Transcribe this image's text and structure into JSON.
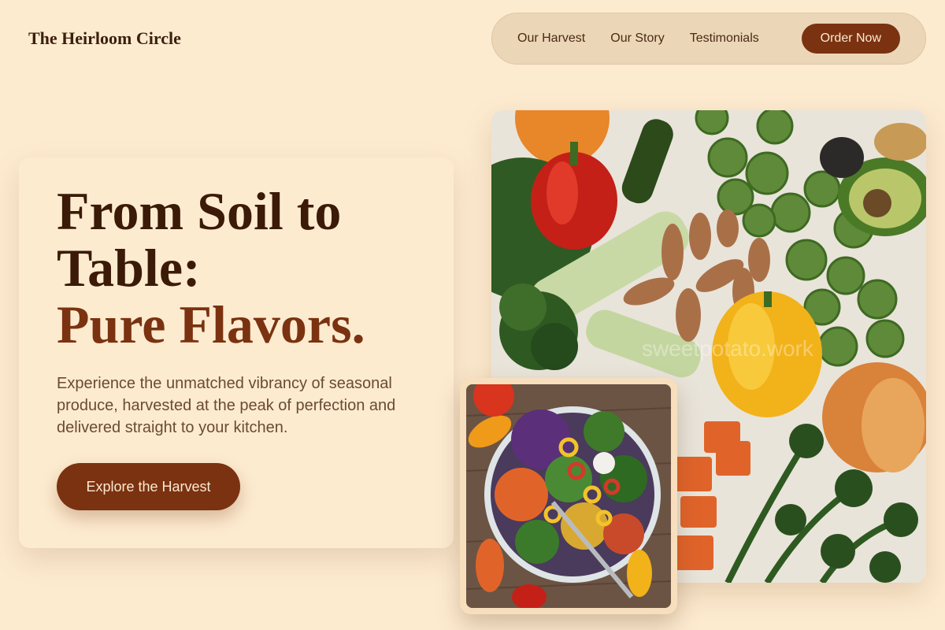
{
  "brand": {
    "name": "The Heirloom Circle"
  },
  "nav": {
    "items": [
      {
        "label": "Our Harvest"
      },
      {
        "label": "Our Story"
      },
      {
        "label": "Testimonials"
      }
    ],
    "order_label": "Order Now"
  },
  "hero": {
    "title_line1": "From Soil to",
    "title_line2": "Table:",
    "title_accent": "Pure Flavors.",
    "description": "Experience the unmatched vibrancy of seasonal produce, harvested at the peak of perfection and delivered straight to your kitchen.",
    "cta_label": "Explore the Harvest"
  },
  "images": {
    "main": "vegetable-assortment-photo",
    "inset": "salad-bowl-photo",
    "watermark": "sweetpotato.work"
  },
  "colors": {
    "background": "#fdebd0",
    "accent": "#7a3210",
    "nav_pill": "#ecd6b8",
    "text_dark": "#3b1a08"
  }
}
